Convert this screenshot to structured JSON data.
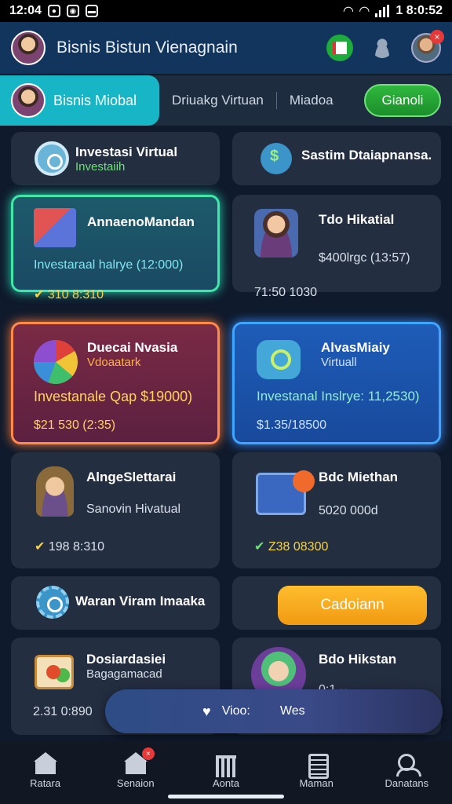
{
  "status_bar": {
    "time": "12:04",
    "clock": "1 8:0:52"
  },
  "header": {
    "title": "Bisnis Bistun Vienagnain",
    "badge": "×"
  },
  "tabs": {
    "active": "Bisnis Miobal",
    "second": "Driuakg Virtuan",
    "third": "Miadoa",
    "button": "Gianoli"
  },
  "cards": {
    "c1": {
      "title": "Investasi Virtual",
      "sub": "Investaiih"
    },
    "c2": {
      "title": "Sastim Dtaiapnansa."
    },
    "c3": {
      "title": "AnnaenoMandan",
      "line": "Investaraal halrye (12:000)",
      "foot": "310 8:310"
    },
    "c4": {
      "title": "Tdo Hikatial",
      "line": "$400lrgc (13:57)",
      "foot": "71:50 1030"
    },
    "c5": {
      "title": "Duecai Nvasia",
      "sub": "Vdoaatark",
      "line": "Investanale Qap $19000)",
      "foot": "$21 530 (2:35)"
    },
    "c6": {
      "title": "AlvasMiaiy",
      "sub": "Virtuall",
      "line": "Investanal Inslrye: 11,2530)",
      "foot": "$1.35/18500"
    },
    "c7": {
      "title": "AlngeSlettarai",
      "line": "Sanovin Hivatual",
      "foot": "198 8:310"
    },
    "c8": {
      "title": "Bdc Miethan",
      "line": "5020 000d",
      "foot": "Z38 08300"
    },
    "c9": {
      "title": "Waran Viram Imaaka"
    },
    "c10": {
      "button": "Cadoiann"
    },
    "c11": {
      "title": "Dosiardasiei",
      "sub": "Bagagamacad",
      "foot": "2.31 0:890"
    },
    "c12": {
      "title": "Bdo Hikstan",
      "foot": "0:1 ··"
    }
  },
  "pill": {
    "left": "Vioo: ",
    "right": "Wes"
  },
  "nav": [
    {
      "label": "Ratara"
    },
    {
      "label": "Senaion"
    },
    {
      "label": "Aonta"
    },
    {
      "label": "Maman"
    },
    {
      "label": "Danatans"
    }
  ],
  "nav_badge": "×"
}
